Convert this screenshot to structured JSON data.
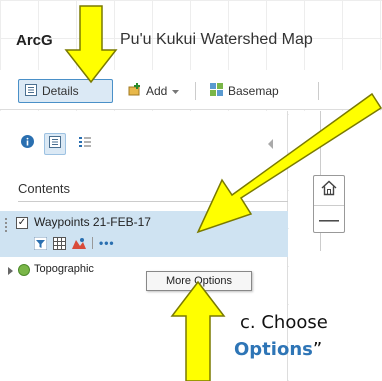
{
  "header": {
    "app_name": "ArcG",
    "map_title": "Pu'u Kukui Watershed Map"
  },
  "toolbar": {
    "details_label": "Details",
    "add_label": "Add",
    "basemap_label": "Basemap"
  },
  "panel": {
    "contents_heading": "Contents",
    "layers": [
      {
        "name": "Waypoints 21-FEB-17",
        "checked": true
      },
      {
        "name": "Topographic"
      }
    ],
    "tooltip": "More Options"
  },
  "instruction": {
    "line1": "c. Choose",
    "line2_highlight": "Options",
    "line2_suffix": "”"
  },
  "colors": {
    "arrow_fill": "#ffff00",
    "arrow_stroke": "#7a7a00",
    "accent": "#2e75b6",
    "selected_bg": "#cfe3f2"
  }
}
